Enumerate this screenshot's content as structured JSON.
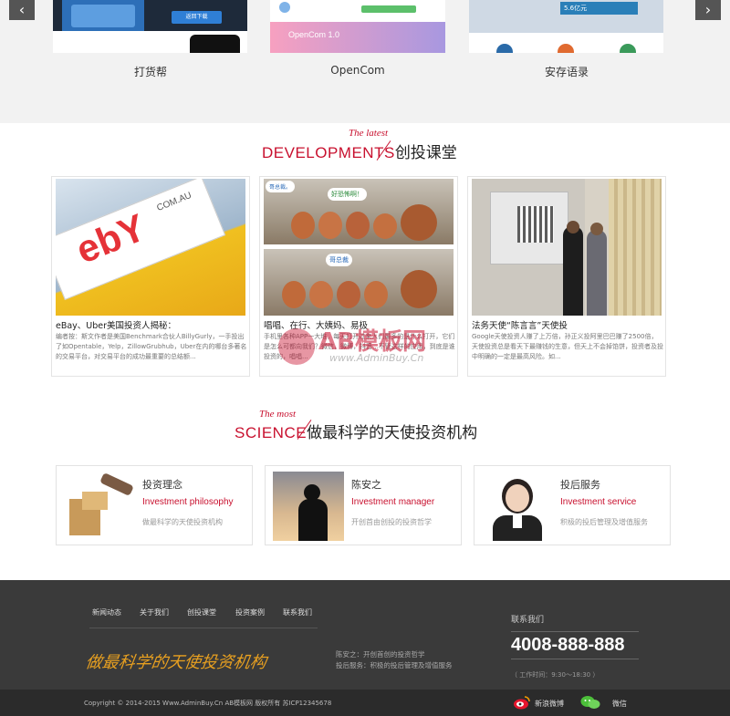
{
  "carousel": {
    "prev": "‹",
    "next": "›",
    "items": [
      {
        "caption": "打货帮",
        "inner_button": "返回下载"
      },
      {
        "caption": "OpenCom",
        "inner_text": "OpenCom 1.0"
      },
      {
        "caption": "安存语录",
        "inner_text": "5.6亿元"
      }
    ]
  },
  "developments": {
    "en": "DEVELOPMENTS",
    "italic": "The latest",
    "zh": "创投课堂",
    "cards": [
      {
        "title": "eBay、Uber美国投资人揭秘：",
        "text": "编者按：斯文作者是美国Benchmark合伙人BillyGurly，一手投出了如Opentable，Yelp，ZillowGrubhub，Uber在内的哪台多著名的交易平台，对交易平台的成功最重要的总结额...",
        "logo_text": "ebY",
        "logo_sub": "COM.AU"
      },
      {
        "title": "唱唱、在行、大姨妈、易极",
        "text": "手机里各种APP一大堆，每天打开过来人们最多的是什么打开，它们是怎么可都向我们？微信，微博，抖音...不管这样的应用，到底是谁投资的，唱唱...",
        "bubble1": "哥总裁。",
        "bubble2": "好恐怖啊！",
        "bubble3": "哥总裁"
      },
      {
        "title": "法务天使“陈言言”天使投",
        "text": "Google天使投资人赚了上万倍，孙正义投阿里巴巴赚了2500倍，天使投资总是看天下最赚钱的生意，但天上不会掉馅饼，投资者及投中明确的一定是最高风险。如..."
      }
    ]
  },
  "science": {
    "en": "SCIENCE",
    "italic": "The most",
    "zh": "做最科学的天使投资机构",
    "items": [
      {
        "title": "投资理念",
        "en": "Investment philosophy",
        "desc": "做最科学的天使投资机构"
      },
      {
        "title": "陈安之",
        "en": "Investment manager",
        "desc": "开创首由创投的投资哲学"
      },
      {
        "title": "投后服务",
        "en": "Investment service",
        "desc": "积极的投后管理及增值服务"
      }
    ]
  },
  "watermark": {
    "main": "AB模板网",
    "sub": "www.AdminBuy.Cn"
  },
  "footer": {
    "nav": [
      "新闻动态",
      "关于我们",
      "创投课堂",
      "投资案例",
      "联系我们"
    ],
    "slogan": "做最科学的天使投资机构",
    "line1": "陈安之：开创首创的投资哲学",
    "line2": "投后服务：积极的投后管理及增值服务",
    "contact_label": "联系我们",
    "phone": "4008-888-888",
    "hours": "（ 工作时间：9:30～18:30 ）",
    "copyright": "Copyright © 2014-2015 Www.AdminBuy.Cn AB模板网 版权所有 苏ICP12345678",
    "weibo": "新浪微博",
    "wechat": "微信"
  },
  "colors": {
    "accent": "#c8102e",
    "footer_bg": "#3a3a3a",
    "bottom_bg": "#2b2b2b",
    "slogan": "#e8a020"
  }
}
